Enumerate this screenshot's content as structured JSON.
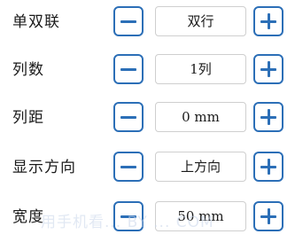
{
  "rows": [
    {
      "label": "单双联",
      "value": "双行"
    },
    {
      "label": "列数",
      "value": "1列"
    },
    {
      "label": "列距",
      "value": "0 mm"
    },
    {
      "label": "显示方向",
      "value": "上方向"
    },
    {
      "label": "宽度",
      "value": "50 mm"
    }
  ],
  "watermark": "用手机看... BY ... COM",
  "colors": {
    "accent": "#2c6fb7",
    "box_border": "#cfcfcf",
    "text": "#1a1a1a"
  },
  "icons": {
    "decrease": "minus-icon",
    "increase": "plus-icon"
  }
}
